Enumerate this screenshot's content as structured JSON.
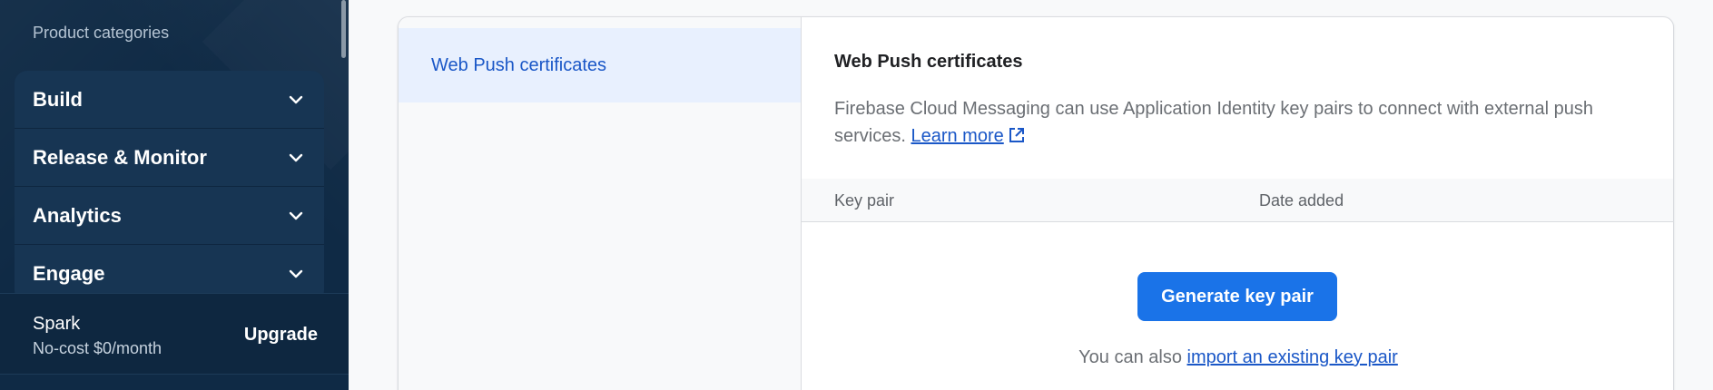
{
  "sidebar": {
    "heading": "Product categories",
    "items": [
      {
        "label": "Build"
      },
      {
        "label": "Release & Monitor"
      },
      {
        "label": "Analytics"
      },
      {
        "label": "Engage"
      }
    ],
    "plan": {
      "name": "Spark",
      "subtitle": "No-cost $0/month",
      "upgrade_label": "Upgrade"
    }
  },
  "nav": {
    "active_item": "Web Push certificates"
  },
  "content": {
    "title": "Web Push certificates",
    "description": "Firebase Cloud Messaging can use Application Identity key pairs to connect with external push services.",
    "learn_more": "Learn more",
    "table": {
      "columns": [
        "Key pair",
        "Date added"
      ]
    },
    "generate_button": "Generate key pair",
    "import_prefix": "You can also",
    "import_link": "import an existing key pair"
  },
  "colors": {
    "sidebar_bg": "#0f2a45",
    "accent": "#1a73e8",
    "link": "#1a57c7"
  }
}
